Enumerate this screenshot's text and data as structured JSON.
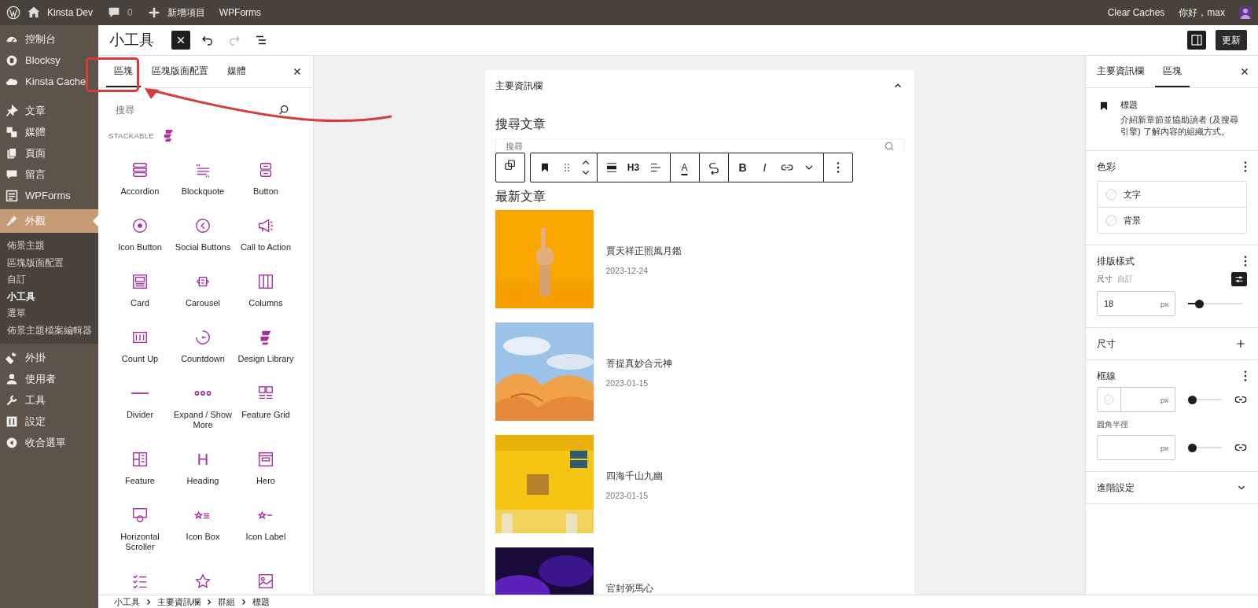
{
  "admin_bar": {
    "site_name": "Kinsta Dev",
    "comments_count": "0",
    "new_label": "新增項目",
    "plugin_link": "WPForms",
    "clear_caches": "Clear Caches",
    "greeting": "你好，max"
  },
  "sidebar": {
    "groups": [
      {
        "items": [
          {
            "label": "控制台",
            "selected": false
          },
          {
            "label": "Blocksy",
            "selected": false
          },
          {
            "label": "Kinsta Cache",
            "selected": false
          }
        ]
      },
      {
        "items": [
          {
            "label": "文章",
            "selected": false
          },
          {
            "label": "媒體",
            "selected": false
          },
          {
            "label": "頁面",
            "selected": false
          },
          {
            "label": "留言",
            "selected": false
          },
          {
            "label": "WPForms",
            "selected": false
          },
          {
            "label": "外觀",
            "selected": true,
            "children": [
              {
                "label": "佈景主題",
                "selected": false
              },
              {
                "label": "區塊版面配置",
                "selected": false
              },
              {
                "label": "自訂",
                "selected": false
              },
              {
                "label": "小工具",
                "selected": true
              },
              {
                "label": "選單",
                "selected": false
              },
              {
                "label": "佈景主題檔案編輯器",
                "selected": false
              }
            ]
          },
          {
            "label": "外掛",
            "selected": false
          },
          {
            "label": "使用者",
            "selected": false
          },
          {
            "label": "工具",
            "selected": false
          },
          {
            "label": "設定",
            "selected": false
          },
          {
            "label": "收合選單",
            "selected": false
          }
        ]
      }
    ]
  },
  "editor_header": {
    "title": "小工具",
    "inserter_open": true,
    "redo_disabled": true,
    "settings_open": true,
    "update_label": "更新"
  },
  "inserter": {
    "tabs": [
      {
        "label": "區塊",
        "selected": true
      },
      {
        "label": "區塊版面配置",
        "selected": false
      },
      {
        "label": "媒體",
        "selected": false
      }
    ],
    "search_placeholder": "搜尋",
    "category": "STACKABLE",
    "blocks": [
      {
        "label": "Accordion"
      },
      {
        "label": "Blockquote"
      },
      {
        "label": "Button"
      },
      {
        "label": "Icon Button"
      },
      {
        "label": "Social Buttons"
      },
      {
        "label": "Call to Action"
      },
      {
        "label": "Card"
      },
      {
        "label": "Carousel"
      },
      {
        "label": "Columns"
      },
      {
        "label": "Count Up"
      },
      {
        "label": "Countdown"
      },
      {
        "label": "Design Library"
      },
      {
        "label": "Divider"
      },
      {
        "label": "Expand / Show More"
      },
      {
        "label": "Feature Grid"
      },
      {
        "label": "Feature"
      },
      {
        "label": "Heading",
        "glyph": "H"
      },
      {
        "label": "Hero"
      },
      {
        "label": "Horizontal Scroller"
      },
      {
        "label": "Icon Box"
      },
      {
        "label": "Icon Label"
      }
    ]
  },
  "canvas": {
    "widget_area": {
      "title": "主要資訊欄",
      "expanded": true,
      "search_heading": "搜尋文章",
      "search_placeholder": "搜尋",
      "latest_heading": "最新文章",
      "posts": [
        {
          "title": "賈天祥正照風月鑑",
          "date": "2023-12-24",
          "kind": "picture"
        },
        {
          "title": "菩提真妙合元神",
          "date": "2023-01-15",
          "kind": "picture"
        },
        {
          "title": "四海千山九幽",
          "date": "2023-01-15",
          "kind": "picture"
        },
        {
          "title": "官封弼馬心",
          "kind": "picture"
        }
      ]
    },
    "block_toolbar": {
      "heading_level": "H3",
      "text_color_glyph": "A",
      "bold_glyph": "B",
      "italic_glyph": "I"
    }
  },
  "settings_panel": {
    "tabs": [
      {
        "label": "主要資訊欄",
        "selected": false
      },
      {
        "label": "區塊",
        "selected": true
      }
    ],
    "block": {
      "name": "標題",
      "description": "介紹新章節並協助讀者 (及搜尋引擎) 了解內容的組織方式。"
    },
    "color": {
      "title": "色彩",
      "items": [
        {
          "label": "文字"
        },
        {
          "label": "背景"
        }
      ]
    },
    "typography": {
      "title": "排版樣式",
      "size_label": "尺寸",
      "size_hint": "自訂",
      "size_value": "18",
      "unit": "px",
      "level": 0.15
    },
    "dimensions": {
      "title": "尺寸"
    },
    "border": {
      "title": "框線",
      "width": {
        "unit": "px",
        "level": 0
      },
      "radius_label": "圓角半徑",
      "radius": {
        "unit": "px",
        "level": 0
      }
    },
    "advanced": {
      "title": "進階設定",
      "expanded": false
    }
  },
  "breadcrumb": [
    "小工具",
    "主要資訊欄",
    "群組",
    "標題"
  ]
}
